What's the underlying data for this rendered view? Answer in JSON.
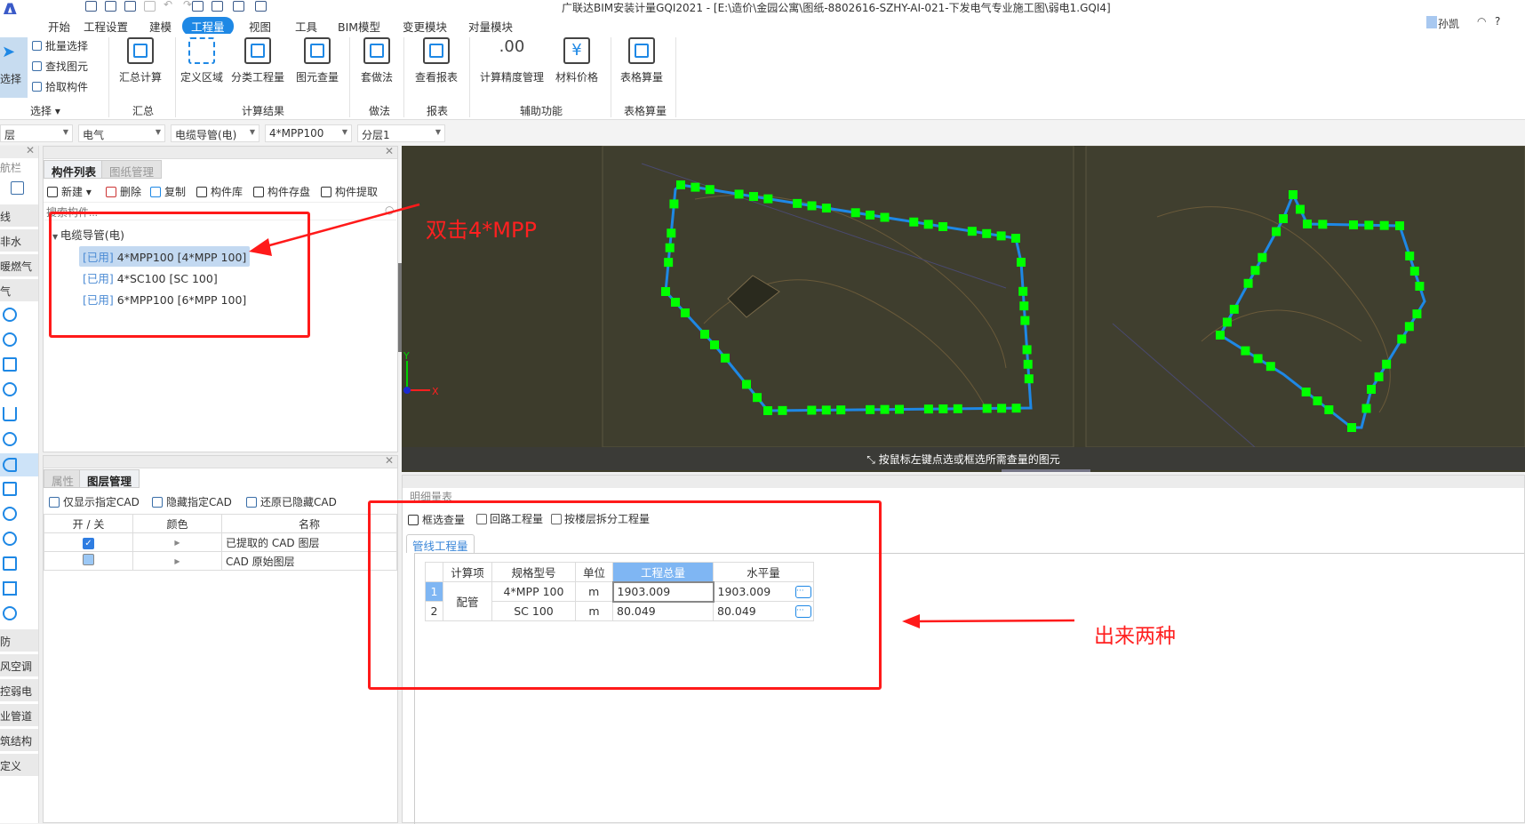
{
  "window": {
    "title": "广联达BIM安装计量GQI2021 - [E:\\造价\\金园公寓\\图纸-8802616-SZHY-AI-021-下发电气专业施工图\\弱电1.GQI4]",
    "user": "孙凯",
    "help": "?"
  },
  "menu": [
    {
      "label": "开始"
    },
    {
      "label": "工程设置"
    },
    {
      "label": "建模"
    },
    {
      "label": "工程量",
      "active": true
    },
    {
      "label": "视图"
    },
    {
      "label": "工具"
    },
    {
      "label": "BIM模型"
    },
    {
      "label": "变更模块"
    },
    {
      "label": "对量模块"
    }
  ],
  "ribbon": {
    "select": {
      "label": "选择",
      "small": [
        "批量选择",
        "查找图元",
        "拾取构件"
      ],
      "group": "选择"
    },
    "buttons": [
      "汇总计算",
      "定义区域",
      "分类工程量",
      "图元查量",
      "套做法",
      "查看报表",
      "计算精度管理",
      "材料价格",
      "表格算量"
    ],
    "groups": [
      "汇总",
      "计算结果",
      "做法",
      "报表",
      "辅助功能",
      "表格算量"
    ]
  },
  "dropdowns": [
    "层",
    "电气",
    "电缆导管(电)",
    "4*MPP100",
    "分层1"
  ],
  "leftnav": {
    "title": "航栏",
    "items": [
      "线",
      "非水",
      "暖燃气",
      "气",
      "防",
      "风空调",
      "控弱电",
      "业管道",
      "筑结构",
      "定义"
    ]
  },
  "component_panel": {
    "tabs": [
      "构件列表",
      "图纸管理"
    ],
    "tools": [
      "新建",
      "删除",
      "复制",
      "构件库",
      "构件存盘",
      "构件提取"
    ],
    "search_placeholder": "搜索构件...",
    "tree": {
      "category": "电缆导管(电)",
      "items": [
        {
          "tag": "[已用]",
          "name": "4*MPP100 [4*MPP 100]",
          "selected": true
        },
        {
          "tag": "[已用]",
          "name": "4*SC100 [SC 100]"
        },
        {
          "tag": "[已用]",
          "name": "6*MPP100 [6*MPP 100]"
        }
      ]
    }
  },
  "layer_panel": {
    "tabs": [
      "属性",
      "图层管理"
    ],
    "tools": [
      "仅显示指定CAD",
      "隐藏指定CAD",
      "还原已隐藏CAD"
    ],
    "headers": [
      "开 / 关",
      "颜色",
      "名称"
    ],
    "rows": [
      {
        "on": true,
        "name": "已提取的 CAD 图层"
      },
      {
        "on": false,
        "name": "CAD 原始图层"
      }
    ]
  },
  "viewport": {
    "hint": "按鼠标左键点选或框选所需查量的图元",
    "axis_x": "X",
    "axis_y": "Y",
    "annotation": "双击4*MPP",
    "colors": {
      "pipe_highlight": "#00ff00",
      "pipe": "#1e88e5",
      "annotation": "#ff2020"
    }
  },
  "quantity_panel": {
    "title": "明细量表",
    "tools": {
      "box_select": "框选查量",
      "circuit": "回路工程量",
      "by_floor": "按楼层拆分工程量"
    },
    "tab": "管线工程量",
    "headers": [
      "计算项",
      "规格型号",
      "单位",
      "工程总量",
      "水平量"
    ],
    "group": "配管",
    "rows": [
      {
        "no": "1",
        "spec": "4*MPP 100",
        "unit": "m",
        "total": "1903.009",
        "horizontal": "1903.009"
      },
      {
        "no": "2",
        "spec": "SC 100",
        "unit": "m",
        "total": "80.049",
        "horizontal": "80.049"
      }
    ]
  },
  "annotation_right": "出来两种"
}
